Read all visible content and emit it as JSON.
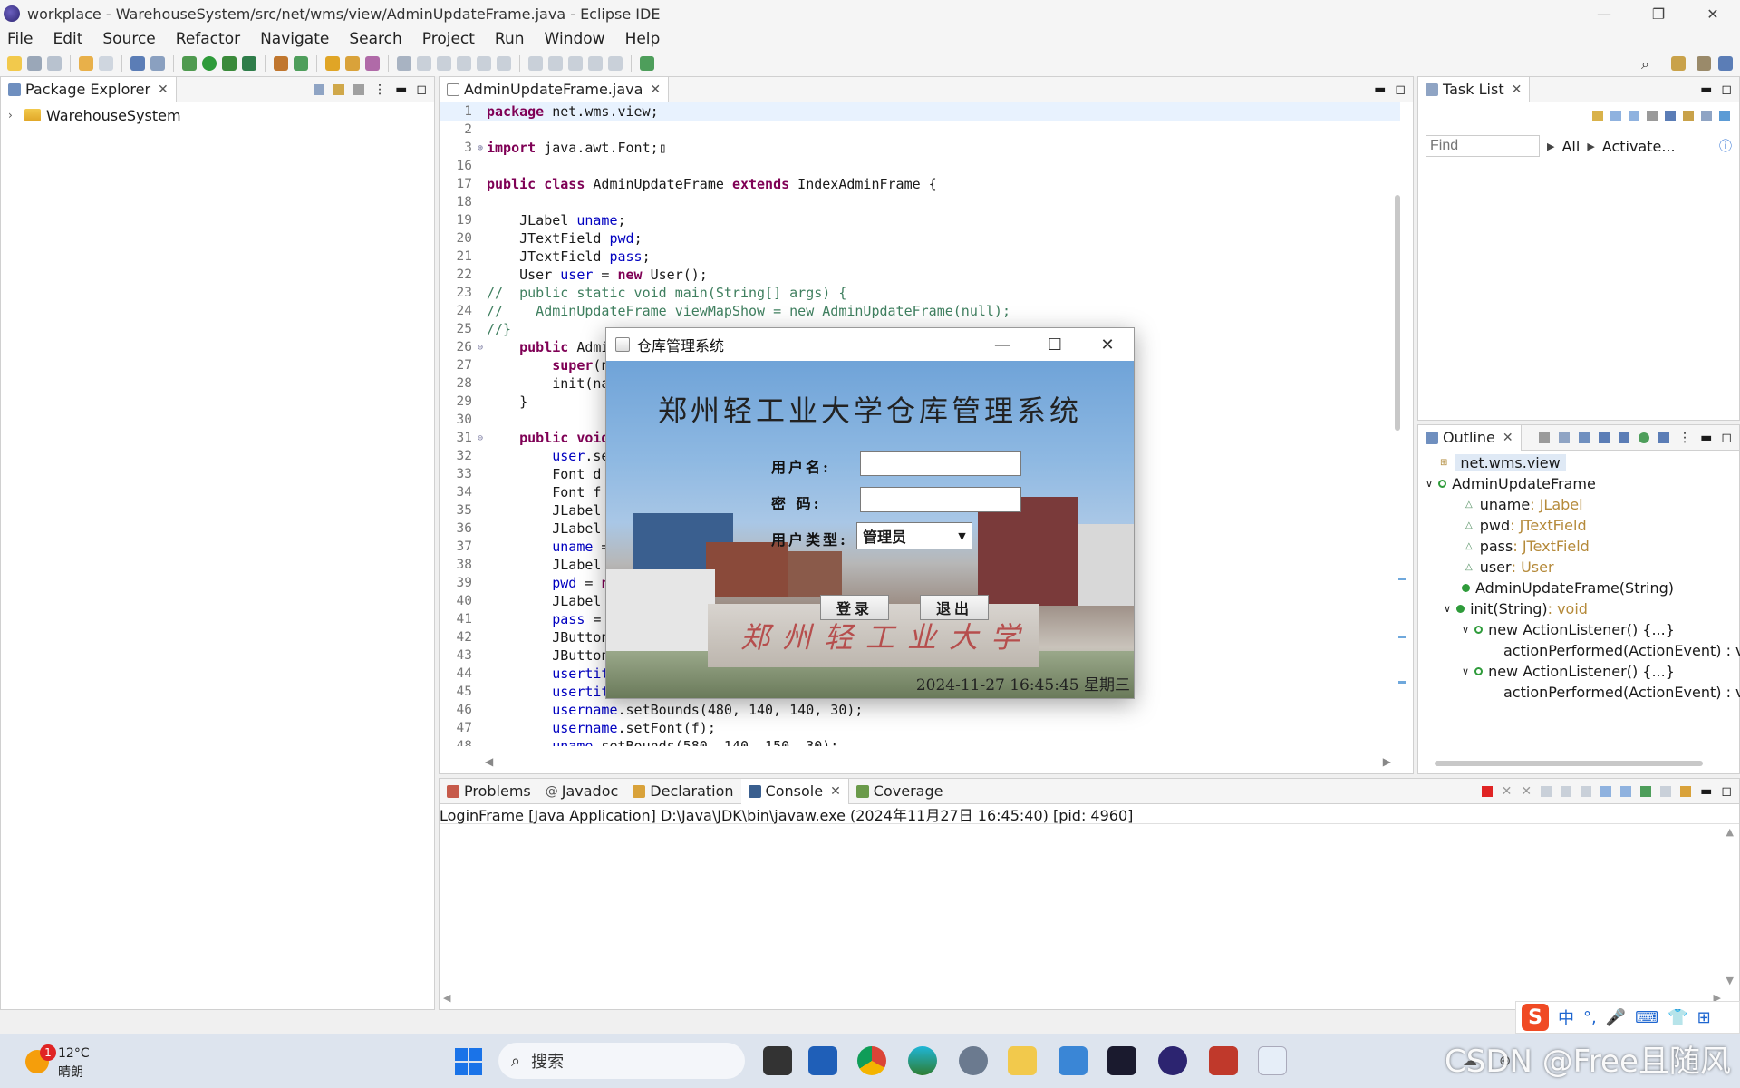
{
  "window": {
    "title": "workplace - WarehouseSystem/src/net/wms/view/AdminUpdateFrame.java - Eclipse IDE",
    "minimize": "—",
    "maximize": "❐",
    "close": "✕"
  },
  "menu": [
    "File",
    "Edit",
    "Source",
    "Refactor",
    "Navigate",
    "Search",
    "Project",
    "Run",
    "Window",
    "Help"
  ],
  "package_explorer": {
    "tab": "Package Explorer",
    "project": "WarehouseSystem"
  },
  "editor": {
    "tab": "AdminUpdateFrame.java",
    "lines": [
      {
        "n": "1",
        "segs": [
          {
            "t": "package",
            "c": "kw"
          },
          {
            "t": " net.wms.view;"
          }
        ]
      },
      {
        "n": "2",
        "segs": []
      },
      {
        "n": "3",
        "fold": "⊕",
        "segs": [
          {
            "t": "import",
            "c": "kw"
          },
          {
            "t": " java.awt.Font;▯"
          }
        ]
      },
      {
        "n": "16",
        "segs": []
      },
      {
        "n": "17",
        "segs": [
          {
            "t": "public class",
            "c": "kw"
          },
          {
            "t": " AdminUpdateFrame "
          },
          {
            "t": "extends",
            "c": "kw"
          },
          {
            "t": " IndexAdminFrame {"
          }
        ]
      },
      {
        "n": "18",
        "segs": []
      },
      {
        "n": "19",
        "segs": [
          {
            "t": "    JLabel "
          },
          {
            "t": "uname",
            "c": "fld"
          },
          {
            "t": ";"
          }
        ]
      },
      {
        "n": "20",
        "segs": [
          {
            "t": "    JTextField "
          },
          {
            "t": "pwd",
            "c": "fld"
          },
          {
            "t": ";"
          }
        ]
      },
      {
        "n": "21",
        "segs": [
          {
            "t": "    JTextField "
          },
          {
            "t": "pass",
            "c": "fld"
          },
          {
            "t": ";"
          }
        ]
      },
      {
        "n": "22",
        "segs": [
          {
            "t": "    User "
          },
          {
            "t": "user",
            "c": "fld"
          },
          {
            "t": " = "
          },
          {
            "t": "new",
            "c": "kw"
          },
          {
            "t": " User();"
          }
        ]
      },
      {
        "n": "23",
        "segs": [
          {
            "t": "//  public static void main(String[] args) {",
            "c": "cmt"
          }
        ]
      },
      {
        "n": "24",
        "segs": [
          {
            "t": "//    AdminUpdateFrame viewMapShow = new AdminUpdateFrame(null);",
            "c": "cmt"
          }
        ]
      },
      {
        "n": "25",
        "segs": [
          {
            "t": "//}",
            "c": "cmt"
          }
        ]
      },
      {
        "n": "26",
        "fold": "⊖",
        "segs": [
          {
            "t": "    "
          },
          {
            "t": "public",
            "c": "kw"
          },
          {
            "t": " Admi"
          }
        ]
      },
      {
        "n": "27",
        "segs": [
          {
            "t": "        "
          },
          {
            "t": "super",
            "c": "kw"
          },
          {
            "t": "(n"
          }
        ]
      },
      {
        "n": "28",
        "segs": [
          {
            "t": "        init(na"
          }
        ]
      },
      {
        "n": "29",
        "segs": [
          {
            "t": "    }"
          }
        ]
      },
      {
        "n": "30",
        "segs": []
      },
      {
        "n": "31",
        "fold": "⊖",
        "segs": [
          {
            "t": "    "
          },
          {
            "t": "public void",
            "c": "kw"
          }
        ]
      },
      {
        "n": "32",
        "segs": [
          {
            "t": "        "
          },
          {
            "t": "user",
            "c": "fld"
          },
          {
            "t": ".se"
          }
        ]
      },
      {
        "n": "33",
        "segs": [
          {
            "t": "        Font d"
          }
        ]
      },
      {
        "n": "34",
        "segs": [
          {
            "t": "        Font f"
          }
        ]
      },
      {
        "n": "35",
        "segs": [
          {
            "t": "        JLabel"
          }
        ]
      },
      {
        "n": "36",
        "segs": [
          {
            "t": "        JLabel"
          }
        ]
      },
      {
        "n": "37",
        "segs": [
          {
            "t": "        "
          },
          {
            "t": "uname",
            "c": "fld"
          },
          {
            "t": " ="
          }
        ]
      },
      {
        "n": "38",
        "segs": [
          {
            "t": "        JLabel"
          }
        ]
      },
      {
        "n": "39",
        "segs": [
          {
            "t": "        "
          },
          {
            "t": "pwd",
            "c": "fld"
          },
          {
            "t": " = "
          },
          {
            "t": "n",
            "c": "kw"
          }
        ]
      },
      {
        "n": "40",
        "segs": [
          {
            "t": "        JLabel"
          }
        ]
      },
      {
        "n": "41",
        "segs": [
          {
            "t": "        "
          },
          {
            "t": "pass",
            "c": "fld"
          },
          {
            "t": " ="
          }
        ]
      },
      {
        "n": "42",
        "segs": [
          {
            "t": "        JButton"
          }
        ]
      },
      {
        "n": "43",
        "segs": [
          {
            "t": "        JButton"
          }
        ]
      },
      {
        "n": "44",
        "segs": [
          {
            "t": "        "
          },
          {
            "t": "usertit",
            "c": "fld"
          }
        ]
      },
      {
        "n": "45",
        "segs": [
          {
            "t": "        "
          },
          {
            "t": "usertit",
            "c": "fld"
          }
        ]
      },
      {
        "n": "46",
        "segs": [
          {
            "t": "        "
          },
          {
            "t": "username",
            "c": "fld"
          },
          {
            "t": ".setBounds(480, 140, 140, 30);"
          }
        ]
      },
      {
        "n": "47",
        "segs": [
          {
            "t": "        "
          },
          {
            "t": "username",
            "c": "fld"
          },
          {
            "t": ".setFont(f);"
          }
        ]
      },
      {
        "n": "48",
        "segs": [
          {
            "t": "        "
          },
          {
            "t": "uname",
            "c": "fld"
          },
          {
            "t": ".setBounds(580, 140, 150, 30);"
          }
        ]
      }
    ]
  },
  "task_list": {
    "tab": "Task List",
    "find_placeholder": "Find",
    "all": "All",
    "activate": "Activate..."
  },
  "outline": {
    "tab": "Outline",
    "package": "net.wms.view",
    "class_name": "AdminUpdateFrame",
    "fields": [
      {
        "name": "uname",
        "type": " : JLabel"
      },
      {
        "name": "pwd",
        "type": " : JTextField"
      },
      {
        "name": "pass",
        "type": " : JTextField"
      },
      {
        "name": "user",
        "type": " : User"
      }
    ],
    "constructor": "AdminUpdateFrame(String)",
    "method": "init(String)",
    "method_type": " : void",
    "listener1": "new ActionListener() {...}",
    "action1": "actionPerformed(ActionEvent) : vo",
    "listener2": "new ActionListener() {...}",
    "action2": "actionPerformed(ActionEvent) : vo"
  },
  "bottom_tabs": [
    "Problems",
    "Javadoc",
    "Declaration",
    "Console",
    "Coverage"
  ],
  "console": {
    "header": "LoginFrame [Java Application] D:\\Java\\JDK\\bin\\javaw.exe  (2024年11月27日 16:45:40) [pid: 4960]"
  },
  "dialog": {
    "title": "仓库管理系统",
    "heading": "郑州轻工业大学仓库管理系统",
    "username_label": "用户名:",
    "password_label": "密  码:",
    "usertype_label": "用户类型:",
    "usertype_value": "管理员",
    "login_button": "登录",
    "exit_button": "退出",
    "gate_text": "郑州轻工业大学",
    "clock": "2024-11-27 16:45:45 星期三"
  },
  "taskbar": {
    "temperature": "12°C",
    "weather": "晴朗",
    "notification_count": "1",
    "search_placeholder": "搜索",
    "ime_label": "中",
    "watermark": "CSDN @Free且随风"
  },
  "colors": {
    "keyword": "#7f0055",
    "field": "#0000c0",
    "comment": "#3f7f5f",
    "accent": "#1a73e8"
  }
}
